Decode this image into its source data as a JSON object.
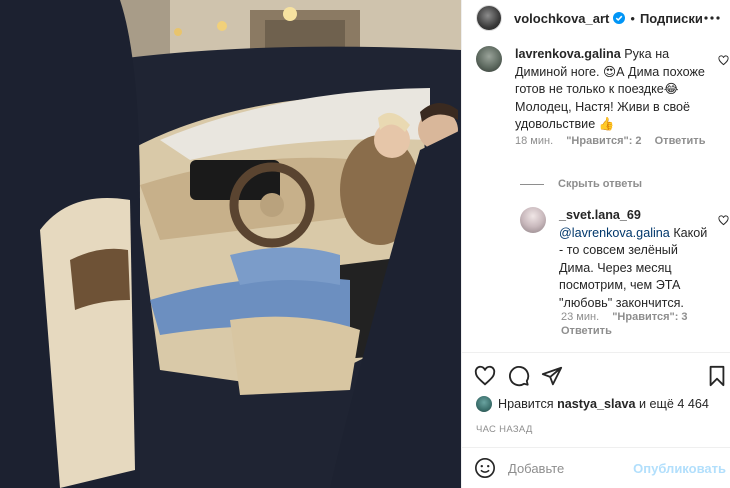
{
  "post": {
    "author": "volochkova_art",
    "separator": "•",
    "follow_label": "Подписки"
  },
  "comments": [
    {
      "username": "lavrenkova.galina",
      "text": "Рука на Диминой ноге. 😍А Дима похоже готов не только к поездке😂 Молодец, Настя! Живи в своё удовольствие 👍",
      "time": "18 мин.",
      "likes": "\"Нравится\": 2",
      "reply_label": "Ответить"
    },
    {
      "username": "_svet.lana_69",
      "mention": "@lavrenkova.galina",
      "text": "Какой - то совсем зелёный Дима. Через месяц посмотрим, чем ЭТА \"любовь\" закончится.",
      "time": "23 мин.",
      "likes": "\"Нравится\": 3",
      "reply_label": "Ответить"
    }
  ],
  "hide_replies_label": "Скрыть ответы",
  "likes_line": {
    "prefix": "Нравится",
    "user": "nastya_slava",
    "suffix": "и ещё 4 464"
  },
  "timestamp": "ЧАС НАЗАД",
  "add_comment": {
    "placeholder": "Добавьте",
    "publish_label": "Опубликовать"
  },
  "icons": {
    "verified": "verified-badge-icon",
    "more": "more-options-icon",
    "like": "heart-icon",
    "comment": "comment-bubble-icon",
    "share": "paper-plane-icon",
    "save": "bookmark-icon",
    "emoji": "emoji-smile-icon"
  },
  "colors": {
    "text": "#262626",
    "muted": "#8e8e8e",
    "verified": "#0095f6",
    "publish_disabled": "#b2dffc",
    "mention": "#00376b"
  }
}
